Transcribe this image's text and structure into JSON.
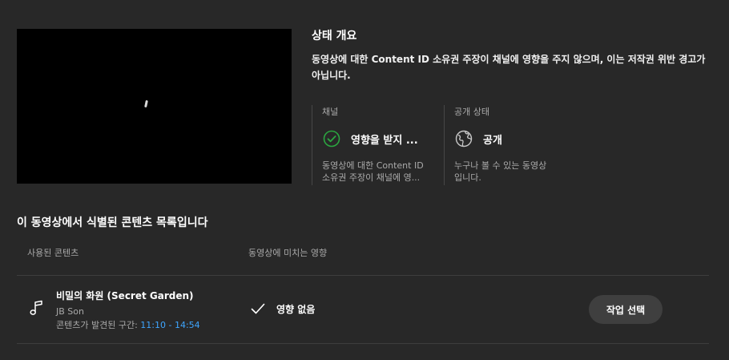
{
  "summary": {
    "title": "상태 개요",
    "description": "동영상에 대한 Content ID 소유권 주장이 채널에 영향을 주지 않으며, 이는 저작권 위반 경고가 아닙니다."
  },
  "status_cards": {
    "channel": {
      "label": "채널",
      "value": "영향을 받지 ...",
      "desc_line1": "동영상에 대한 Content ID",
      "desc_line2": "소유권 주장이 채널에 영...",
      "icon": "check-circle-icon",
      "icon_color": "#2ba640"
    },
    "visibility": {
      "label": "공개 상태",
      "value": "공개",
      "desc_line1": "누구나 볼 수 있는 동영상",
      "desc_line2": "입니다.",
      "icon": "globe-icon"
    }
  },
  "content_section": {
    "title": "이 동영상에서 식별된 콘텐츠 목록입니다",
    "col_content": "사용된 콘텐츠",
    "col_impact": "동영상에 미치는 영향",
    "rows": [
      {
        "icon": "music-note-icon",
        "title": "비밀의 화원 (Secret Garden)",
        "artist": "JB Son",
        "range_label": "콘텐츠가 발견된 구간: ",
        "range_time": "11:10 - 14:54",
        "impact": "영향 없음",
        "action": "작업 선택"
      }
    ]
  },
  "colors": {
    "background": "#282828",
    "accent_link": "#3ea6ff",
    "success": "#2ba640"
  }
}
